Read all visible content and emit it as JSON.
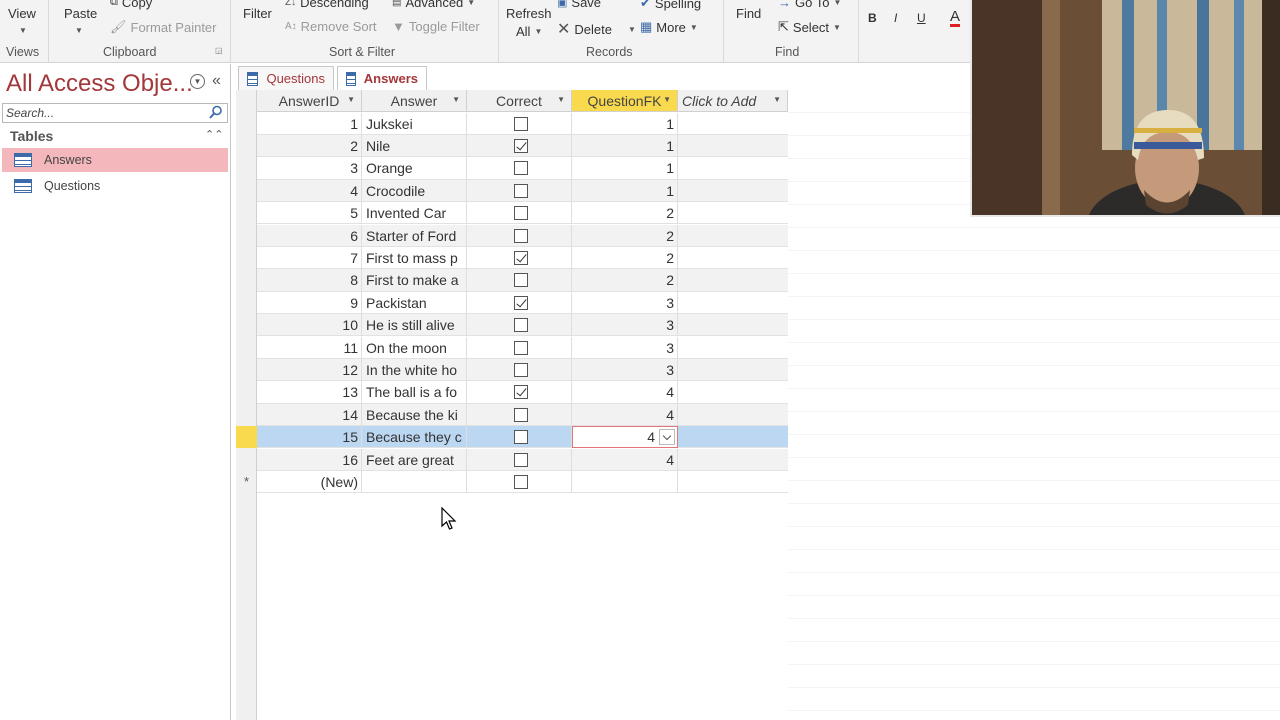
{
  "ribbon": {
    "views": {
      "view_label": "View",
      "group_label": "Views"
    },
    "clipboard": {
      "paste_label": "Paste",
      "copy_label": "Copy",
      "format_painter_label": "Format Painter",
      "group_label": "Clipboard"
    },
    "sort_filter": {
      "filter_label": "Filter",
      "descending_label": "Descending",
      "remove_sort_label": "Remove Sort",
      "advanced_label": "Advanced",
      "toggle_filter_label": "Toggle Filter",
      "group_label": "Sort & Filter"
    },
    "records": {
      "refresh_label": "Refresh",
      "refresh_all_label": "All",
      "save_label": "Save",
      "delete_label": "Delete",
      "spelling_label": "Spelling",
      "more_label": "More",
      "group_label": "Records"
    },
    "find": {
      "find_label": "Find",
      "goto_label": "Go To",
      "select_label": "Select",
      "group_label": "Find"
    },
    "text": {
      "bold": "B",
      "italic": "I",
      "underline": "U",
      "font_color": "A"
    }
  },
  "nav": {
    "title": "All Access Obje...",
    "search_placeholder": "Search...",
    "category": "Tables",
    "items": [
      {
        "label": "Answers",
        "selected": true
      },
      {
        "label": "Questions",
        "selected": false
      }
    ]
  },
  "tabs": [
    {
      "label": "Questions",
      "active": false
    },
    {
      "label": "Answers",
      "active": true
    }
  ],
  "table": {
    "columns": [
      "AnswerID",
      "Answer",
      "Correct",
      "QuestionFK",
      "Click to Add"
    ],
    "active_column": "QuestionFK",
    "rows": [
      {
        "id": "1",
        "answer": "Jukskei",
        "correct": false,
        "qfk": "1"
      },
      {
        "id": "2",
        "answer": "Nile",
        "correct": true,
        "qfk": "1"
      },
      {
        "id": "3",
        "answer": "Orange",
        "correct": false,
        "qfk": "1"
      },
      {
        "id": "4",
        "answer": "Crocodile",
        "correct": false,
        "qfk": "1"
      },
      {
        "id": "5",
        "answer": "Invented Car",
        "correct": false,
        "qfk": "2"
      },
      {
        "id": "6",
        "answer": "Starter of Ford",
        "correct": false,
        "qfk": "2"
      },
      {
        "id": "7",
        "answer": "First to mass p",
        "correct": true,
        "qfk": "2"
      },
      {
        "id": "8",
        "answer": "First to make a",
        "correct": false,
        "qfk": "2"
      },
      {
        "id": "9",
        "answer": "Packistan",
        "correct": true,
        "qfk": "3"
      },
      {
        "id": "10",
        "answer": "He is still alive",
        "correct": false,
        "qfk": "3"
      },
      {
        "id": "11",
        "answer": "On the moon",
        "correct": false,
        "qfk": "3"
      },
      {
        "id": "12",
        "answer": "In the white ho",
        "correct": false,
        "qfk": "3"
      },
      {
        "id": "13",
        "answer": "The ball is a fo",
        "correct": true,
        "qfk": "4"
      },
      {
        "id": "14",
        "answer": "Because the ki",
        "correct": false,
        "qfk": "4"
      },
      {
        "id": "15",
        "answer": "Because they c",
        "correct": false,
        "qfk": "4",
        "current": true
      },
      {
        "id": "16",
        "answer": "Feet are great",
        "correct": false,
        "qfk": "4"
      }
    ],
    "new_row_label": "(New)",
    "new_row_marker": "*"
  },
  "colors": {
    "accent": "#a4373a",
    "active_header": "#f9d94d",
    "selected_row": "#bcd7f2",
    "nav_selected": "#f4b8bc"
  }
}
